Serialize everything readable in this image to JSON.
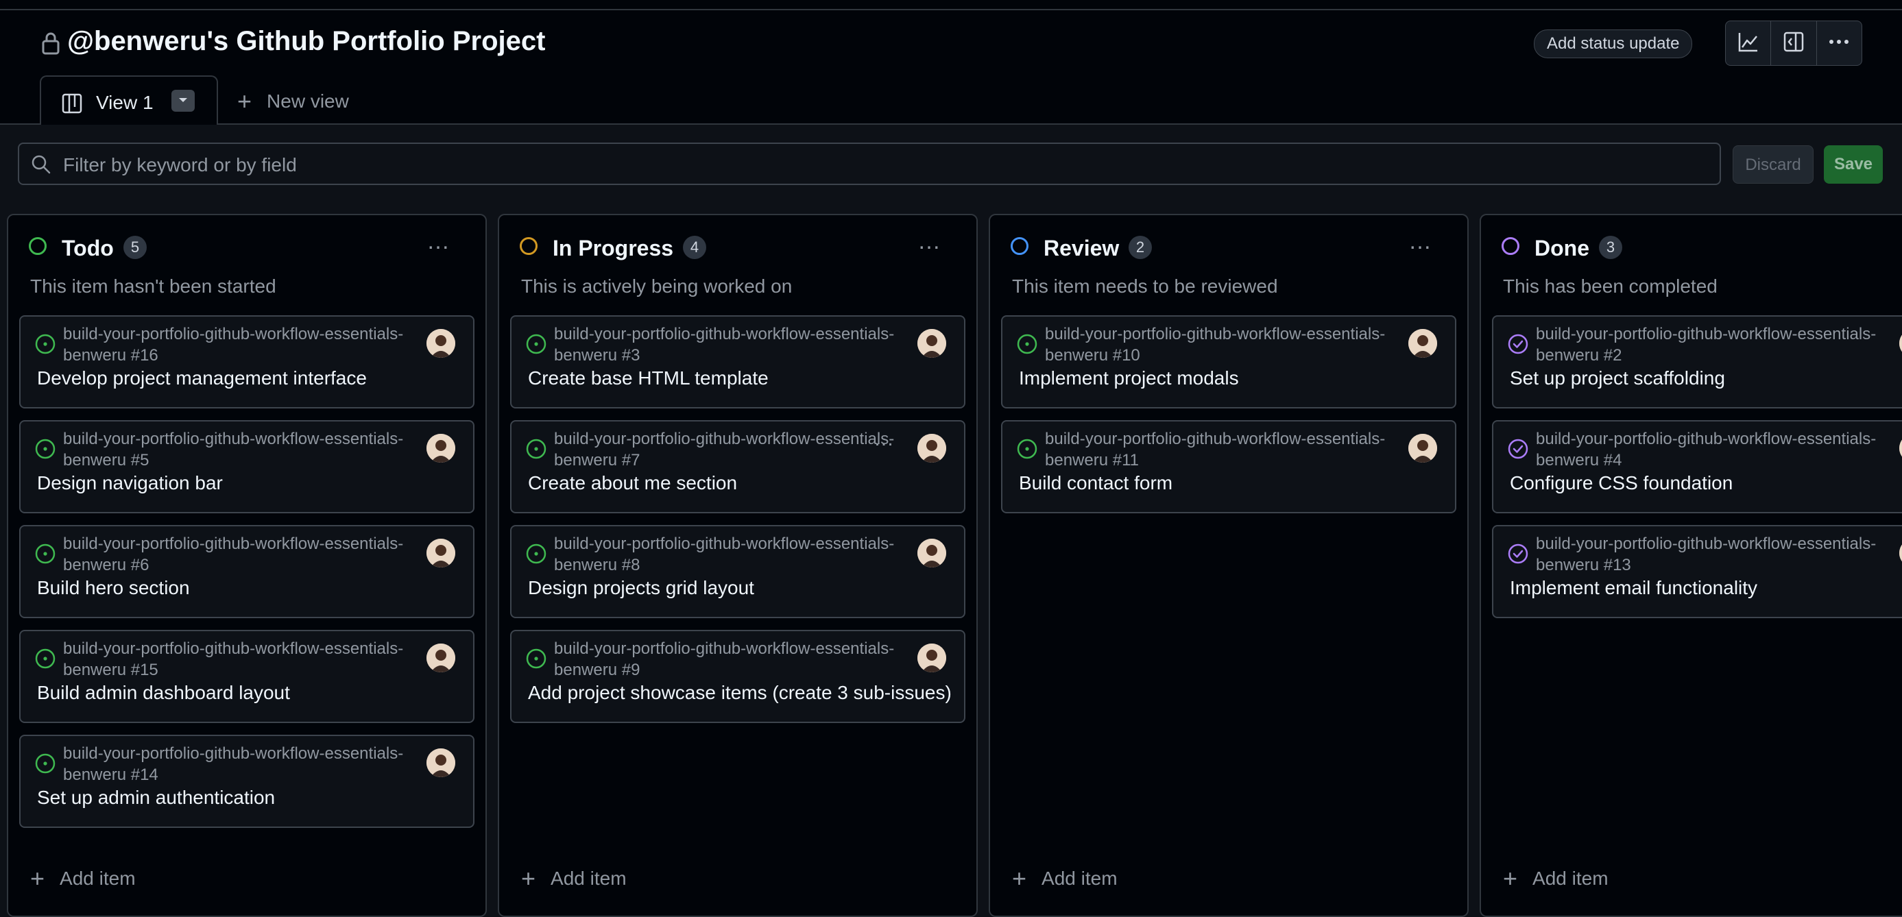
{
  "header": {
    "title": "@benweru's Github Portfolio Project",
    "status_button": "Add status update",
    "lock_icon": "lock-icon",
    "tools": [
      "insights-graph-icon",
      "sidepanel-icon",
      "kebab-horizontal-icon"
    ]
  },
  "tabs": {
    "active": {
      "label": "View 1",
      "icon": "project-board-icon"
    },
    "new_view": "New view"
  },
  "filter": {
    "placeholder": "Filter by keyword or by field",
    "discard": "Discard",
    "save": "Save"
  },
  "colors": {
    "todo": "#3fb950",
    "in_progress": "#d29922",
    "review": "#4493f8",
    "done": "#ab7df8",
    "open_issue": "#3fb950",
    "closed_issue": "#ab7df8"
  },
  "columns": [
    {
      "name": "Todo",
      "count": "5",
      "description": "This item hasn't been started",
      "add_label": "Add item",
      "cards": [
        {
          "repo": "build-your-portfolio-github-workflow-essentials-benweru #16",
          "title": "Develop project management interface"
        },
        {
          "repo": "build-your-portfolio-github-workflow-essentials-benweru #5",
          "title": "Design navigation bar"
        },
        {
          "repo": "build-your-portfolio-github-workflow-essentials-benweru #6",
          "title": "Build hero section"
        },
        {
          "repo": "build-your-portfolio-github-workflow-essentials-benweru #15",
          "title": "Build admin dashboard layout"
        },
        {
          "repo": "build-your-portfolio-github-workflow-essentials-benweru #14",
          "title": "Set up admin authentication"
        }
      ]
    },
    {
      "name": "In Progress",
      "count": "4",
      "description": "This is actively being worked on",
      "add_label": "Add item",
      "cards": [
        {
          "repo": "build-your-portfolio-github-workflow-essentials-benweru #3",
          "title": "Create base HTML template"
        },
        {
          "repo": "build-your-portfolio-github-workflow-essentials-benweru #7",
          "title": "Create about me section"
        },
        {
          "repo": "build-your-portfolio-github-workflow-essentials-benweru #8",
          "title": "Design projects grid layout"
        },
        {
          "repo": "build-your-portfolio-github-workflow-essentials-benweru #9",
          "title": "Add project showcase items (create 3 sub-issues)"
        }
      ]
    },
    {
      "name": "Review",
      "count": "2",
      "description": "This item needs to be reviewed",
      "add_label": "Add item",
      "cards": [
        {
          "repo": "build-your-portfolio-github-workflow-essentials-benweru #10",
          "title": "Implement project modals"
        },
        {
          "repo": "build-your-portfolio-github-workflow-essentials-benweru #11",
          "title": "Build contact form"
        }
      ]
    },
    {
      "name": "Done",
      "count": "3",
      "description": "This has been completed",
      "add_label": "Add item",
      "cards": [
        {
          "repo": "build-your-portfolio-github-workflow-essentials-benweru #2",
          "title": "Set up project scaffolding"
        },
        {
          "repo": "build-your-portfolio-github-workflow-essentials-benweru #4",
          "title": "Configure CSS foundation"
        },
        {
          "repo": "build-your-portfolio-github-workflow-essentials-benweru #13",
          "title": "Implement email functionality"
        }
      ]
    }
  ]
}
